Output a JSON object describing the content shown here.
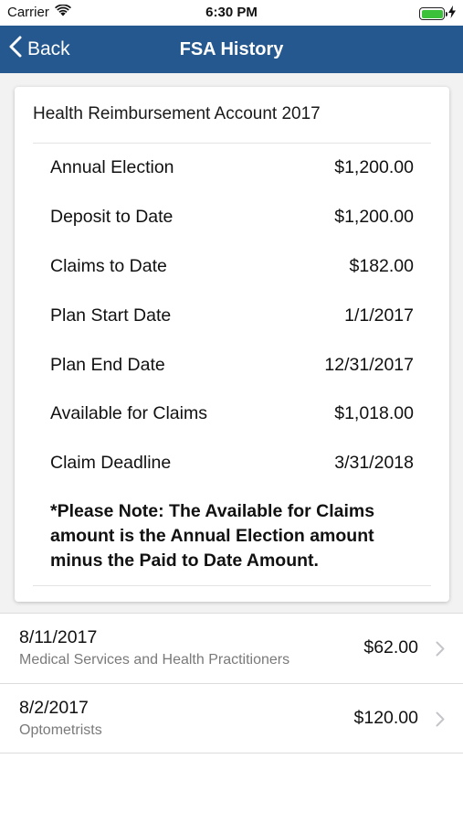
{
  "status_bar": {
    "carrier": "Carrier",
    "time": "6:30 PM",
    "battery_level": 1.0,
    "battery_color": "#3cc13b"
  },
  "nav": {
    "back_label": "Back",
    "title": "FSA History",
    "background_color": "#24588e"
  },
  "account": {
    "title": "Health Reimbursement Account 2017",
    "details": [
      {
        "label": "Annual Election",
        "value": "$1,200.00"
      },
      {
        "label": "Deposit to Date",
        "value": "$1,200.00"
      },
      {
        "label": "Claims to Date",
        "value": "$182.00"
      },
      {
        "label": "Plan Start Date",
        "value": "1/1/2017"
      },
      {
        "label": "Plan End Date",
        "value": "12/31/2017"
      },
      {
        "label": "Available for Claims",
        "value": "$1,018.00"
      },
      {
        "label": "Claim Deadline",
        "value": "3/31/2018"
      }
    ],
    "note": "*Please Note: The Available for Claims amount is the Annual Election amount minus the Paid to Date Amount."
  },
  "history": [
    {
      "date": "8/11/2017",
      "category": "Medical Services and Health Practitioners",
      "amount": "$62.00"
    },
    {
      "date": "8/2/2017",
      "category": "Optometrists",
      "amount": "$120.00"
    }
  ],
  "icons": {
    "wifi": "wifi-icon",
    "battery": "battery-icon",
    "charging": "charging-bolt-icon",
    "back": "chevron-left-icon",
    "disclosure": "chevron-right-icon"
  }
}
